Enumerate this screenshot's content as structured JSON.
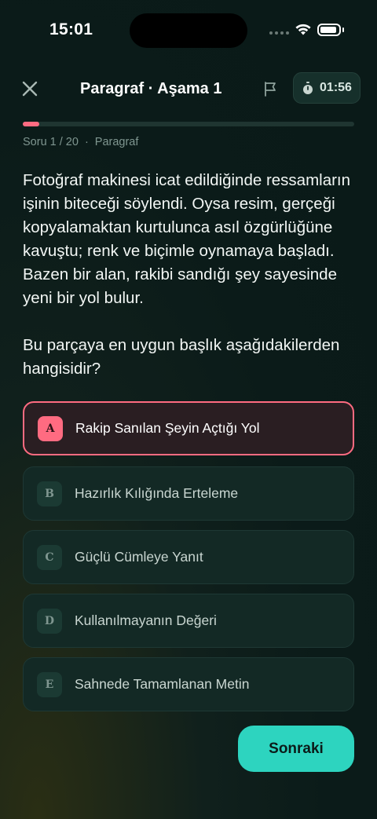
{
  "status_bar": {
    "time": "15:01"
  },
  "header": {
    "title": "Paragraf · Aşama 1",
    "timer": "01:56"
  },
  "progress": {
    "fraction": 0.05
  },
  "meta": {
    "question_counter": "Soru 1 / 20",
    "separator": "·",
    "category": "Paragraf"
  },
  "question": {
    "passage": "Fotoğraf makinesi icat edildiğinde ressamların işinin biteceği söylendi. Oysa resim, gerçeği kopyalamaktan kurtulunca asıl özgürlüğüne kavuştu; renk ve biçimle oynamaya başladı. Bazen bir alan, rakibi sandığı şey sayesinde yeni bir yol bulur.",
    "prompt": "Bu parçaya en uygun başlık aşağıdakilerden hangisidir?"
  },
  "options": [
    {
      "letter": "A",
      "label": "Rakip Sanılan Şeyin Açtığı Yol",
      "selected": true
    },
    {
      "letter": "B",
      "label": "Hazırlık Kılığında Erteleme",
      "selected": false
    },
    {
      "letter": "C",
      "label": "Güçlü Cümleye Yanıt",
      "selected": false
    },
    {
      "letter": "D",
      "label": "Kullanılmayanın Değeri",
      "selected": false
    },
    {
      "letter": "E",
      "label": "Sahnede Tamamlanan Metin",
      "selected": false
    }
  ],
  "next_button": {
    "label": "Sonraki"
  },
  "colors": {
    "accent": "#ff6b81",
    "primary": "#2dd4bf",
    "background": "#0b1b19"
  }
}
